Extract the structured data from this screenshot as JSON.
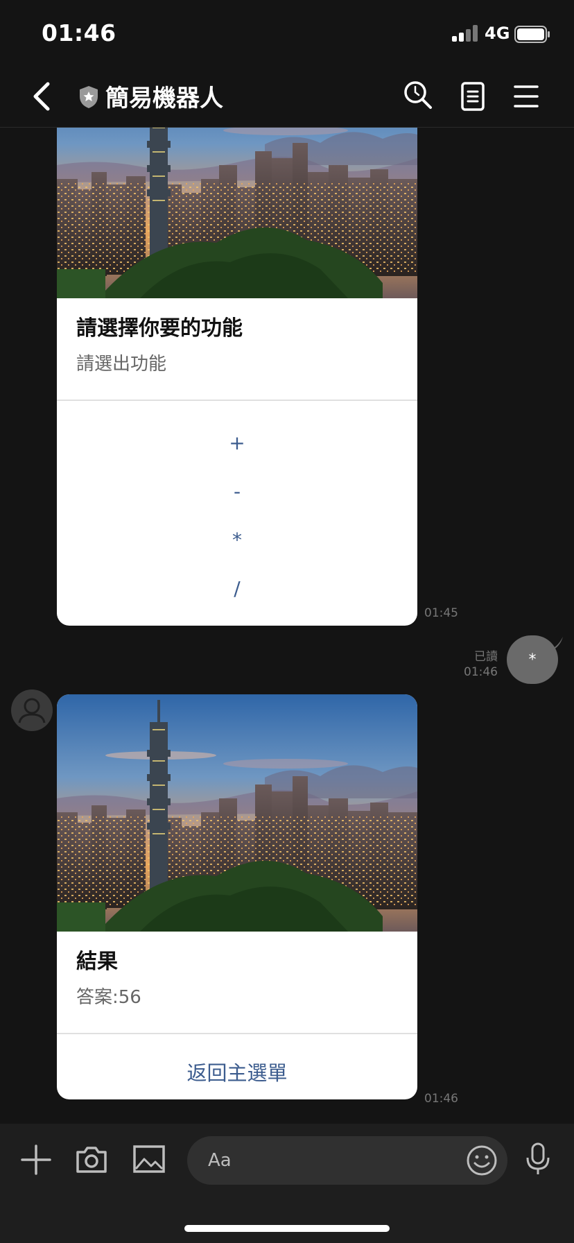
{
  "status_bar": {
    "time": "01:46",
    "network": "4G"
  },
  "header": {
    "title": "簡易機器人",
    "icons": [
      "back-icon",
      "shield-icon",
      "search-icon",
      "notes-icon",
      "menu-icon"
    ]
  },
  "messages": {
    "card1": {
      "title": "請選擇你要的功能",
      "subtitle": "請選出功能",
      "options": [
        "+",
        "-",
        "*",
        "/"
      ],
      "time": "01:45"
    },
    "sent": {
      "text": "*",
      "read_label": "已讀",
      "time": "01:46"
    },
    "card2": {
      "title": "結果",
      "subtitle": "答案:56",
      "button": "返回主選單",
      "time": "01:46"
    }
  },
  "input_bar": {
    "placeholder": "Aa",
    "icons": [
      "plus-icon",
      "camera-icon",
      "image-icon",
      "emoji-icon",
      "microphone-icon"
    ]
  },
  "colors": {
    "background": "#141414",
    "link": "#3c5c8e",
    "bubble": "#6a6a6a"
  }
}
